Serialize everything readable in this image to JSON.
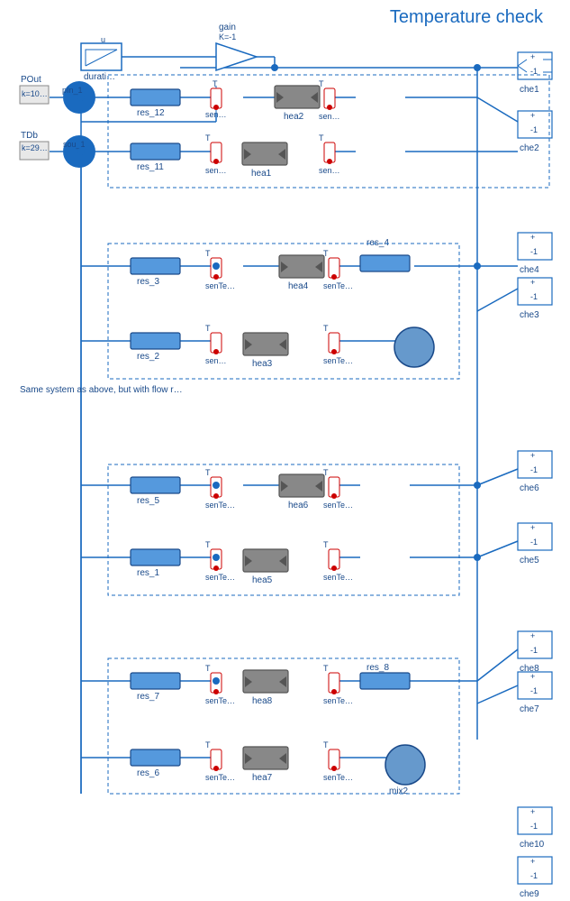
{
  "title": "Temperature check",
  "components": {
    "blocks": [
      {
        "id": "durat",
        "label": "durati…",
        "type": "source"
      },
      {
        "id": "gain",
        "label": "gain\nK=-1",
        "type": "gain"
      },
      {
        "id": "pout",
        "label": "POut",
        "type": "out"
      },
      {
        "id": "tdb",
        "label": "TDb",
        "type": "out"
      },
      {
        "id": "pIn1",
        "label": "pIn_1\nk=10…",
        "type": "junction"
      },
      {
        "id": "sou1",
        "label": "sou_1\nk=29…",
        "type": "junction"
      },
      {
        "id": "res12",
        "label": "res_12"
      },
      {
        "id": "res11",
        "label": "res_11"
      },
      {
        "id": "res3",
        "label": "res_3"
      },
      {
        "id": "res2",
        "label": "res_2"
      },
      {
        "id": "res4",
        "label": "res_4"
      },
      {
        "id": "res5",
        "label": "res_5"
      },
      {
        "id": "res1",
        "label": "res_1"
      },
      {
        "id": "res7",
        "label": "res_7"
      },
      {
        "id": "res6",
        "label": "res_6"
      },
      {
        "id": "res8",
        "label": "res_8"
      },
      {
        "id": "hea1",
        "label": "hea1"
      },
      {
        "id": "hea2",
        "label": "hea2"
      },
      {
        "id": "hea3",
        "label": "hea3"
      },
      {
        "id": "hea4",
        "label": "hea4"
      },
      {
        "id": "hea5",
        "label": "hea5"
      },
      {
        "id": "hea6",
        "label": "hea6"
      },
      {
        "id": "hea7",
        "label": "hea7"
      },
      {
        "id": "hea8",
        "label": "hea8"
      },
      {
        "id": "che1",
        "label": "che1"
      },
      {
        "id": "che2",
        "label": "che2"
      },
      {
        "id": "che3",
        "label": "che3"
      },
      {
        "id": "che4",
        "label": "che4"
      },
      {
        "id": "che5",
        "label": "che5"
      },
      {
        "id": "che6",
        "label": "che6"
      },
      {
        "id": "che7",
        "label": "che7"
      },
      {
        "id": "che8",
        "label": "che8"
      },
      {
        "id": "che9",
        "label": "che9"
      },
      {
        "id": "che10",
        "label": "che10"
      },
      {
        "id": "mix2",
        "label": "mix2"
      }
    ]
  },
  "annotation": "Same system as above, but with flow r…"
}
